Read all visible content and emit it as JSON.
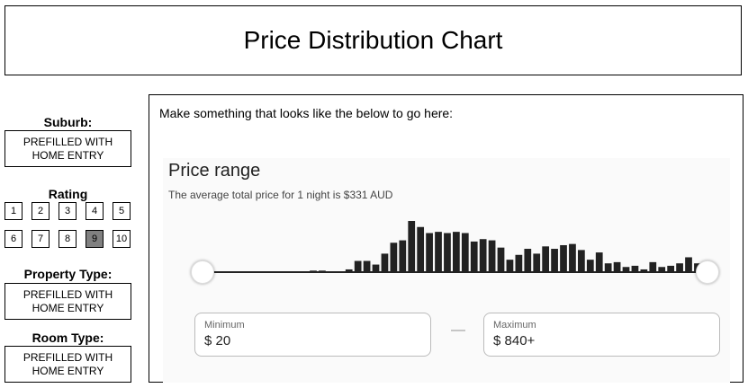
{
  "header": {
    "title": "Price Distribution Chart"
  },
  "sidebar": {
    "suburb": {
      "label": "Suburb:",
      "value": "PREFILLED WITH HOME ENTRY"
    },
    "rating": {
      "label": "Rating",
      "options": [
        "1",
        "2",
        "3",
        "4",
        "5",
        "6",
        "7",
        "8",
        "9",
        "10"
      ],
      "selected": "9"
    },
    "property_type": {
      "label": "Property Type:",
      "value": "PREFILLED WITH HOME ENTRY"
    },
    "room_type": {
      "label": "Room Type:",
      "value": "PREFILLED WITH HOME ENTRY"
    }
  },
  "panel": {
    "instruction": "Make something that looks like the below to go here:",
    "mock": {
      "title": "Price range",
      "subtitle": "The average total price for 1 night is $331 AUD",
      "minimum": {
        "label": "Minimum",
        "value": "$ 20"
      },
      "maximum": {
        "label": "Maximum",
        "value": "$ 840+"
      },
      "separator": "—"
    }
  },
  "chart_data": {
    "type": "bar",
    "title": "",
    "xlabel": "",
    "ylabel": "",
    "x_range": [
      "$ 20",
      "$ 840+"
    ],
    "values": [
      0,
      0,
      0,
      0,
      0,
      0,
      0,
      0,
      0,
      0,
      1,
      1,
      2,
      2,
      1,
      0,
      3,
      10,
      10,
      7,
      16,
      25,
      27,
      43,
      38,
      33,
      34,
      33,
      34,
      33,
      26,
      28,
      27,
      21,
      11,
      15,
      20,
      16,
      22,
      20,
      23,
      24,
      19,
      11,
      17,
      8,
      9,
      5,
      6,
      3,
      9,
      5,
      6,
      8,
      13,
      8
    ]
  }
}
